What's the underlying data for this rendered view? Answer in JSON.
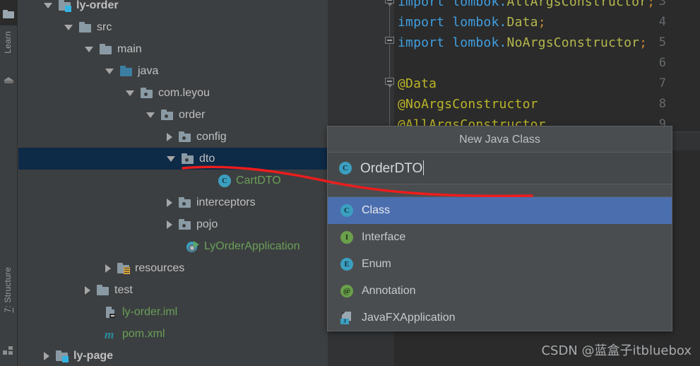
{
  "toolstrip": {
    "project_icon": "folder-icon",
    "learn_tab": "Learn",
    "learn_icon": "graduation-cap-icon",
    "structure_tab_number": "7",
    "structure_tab": ": Structure",
    "structure_icon": "structure-icon"
  },
  "tree": {
    "items": [
      {
        "label": "ly-order",
        "icon": "module-folder-icon",
        "arrow": "down",
        "indent": 36,
        "depth": 0,
        "style": "bold",
        "selected": false
      },
      {
        "label": "src",
        "icon": "folder-icon",
        "arrow": "down",
        "indent": 65,
        "depth": 1,
        "style": "normal",
        "selected": false
      },
      {
        "label": "main",
        "icon": "folder-icon",
        "arrow": "down",
        "indent": 94,
        "depth": 2,
        "style": "normal",
        "selected": false
      },
      {
        "label": "java",
        "icon": "source-folder-icon",
        "arrow": "down",
        "indent": 123,
        "depth": 3,
        "style": "normal",
        "selected": false
      },
      {
        "label": "com.leyou",
        "icon": "package-icon",
        "arrow": "down",
        "indent": 152,
        "depth": 4,
        "style": "normal",
        "selected": false
      },
      {
        "label": "order",
        "icon": "package-icon",
        "arrow": "down",
        "indent": 181,
        "depth": 5,
        "style": "normal",
        "selected": false
      },
      {
        "label": "config",
        "icon": "package-icon",
        "arrow": "right",
        "indent": 210,
        "depth": 6,
        "style": "normal",
        "selected": false
      },
      {
        "label": "dto",
        "icon": "package-icon",
        "arrow": "down",
        "indent": 210,
        "depth": 6,
        "style": "normal",
        "selected": true
      },
      {
        "label": "CartDTO",
        "icon": "java-class-icon",
        "arrow": "blank",
        "indent": 262,
        "depth": 7,
        "style": "green",
        "selected": false
      },
      {
        "label": "interceptors",
        "icon": "package-icon",
        "arrow": "right",
        "indent": 210,
        "depth": 6,
        "style": "normal",
        "selected": false
      },
      {
        "label": "pojo",
        "icon": "package-icon",
        "arrow": "right",
        "indent": 210,
        "depth": 6,
        "style": "normal",
        "selected": false
      },
      {
        "label": "LyOrderApplication",
        "icon": "spring-boot-run-icon",
        "arrow": "blank",
        "indent": 217,
        "depth": 6,
        "style": "green",
        "selected": false
      },
      {
        "label": "resources",
        "icon": "resources-folder-icon",
        "arrow": "right",
        "indent": 123,
        "depth": 3,
        "style": "normal",
        "selected": false
      },
      {
        "label": "test",
        "icon": "folder-icon",
        "arrow": "right",
        "indent": 94,
        "depth": 2,
        "style": "normal",
        "selected": false
      },
      {
        "label": "ly-order.iml",
        "icon": "iml-file-icon",
        "arrow": "blank",
        "indent": 101,
        "depth": 2,
        "style": "green",
        "selected": false
      },
      {
        "label": "pom.xml",
        "icon": "maven-file-icon",
        "arrow": "blank",
        "indent": 101,
        "depth": 2,
        "style": "green",
        "selected": false
      },
      {
        "label": "ly-page",
        "icon": "module-folder-icon",
        "arrow": "right",
        "indent": 36,
        "depth": 0,
        "style": "bold",
        "selected": false
      }
    ]
  },
  "editor": {
    "line_numbers": [
      "3",
      "4",
      "5",
      "6",
      "7",
      "8",
      "9"
    ],
    "lines": [
      {
        "n": "3",
        "tokens": [
          {
            "t": "import",
            "c": "k-kw"
          },
          {
            "t": " lombok.",
            "c": "k-pkg"
          },
          {
            "t": "AllArgsConstructor",
            "c": "k-cls"
          },
          {
            "t": ";",
            "c": "k-sc"
          }
        ]
      },
      {
        "n": "4",
        "tokens": [
          {
            "t": "import",
            "c": "k-kw"
          },
          {
            "t": " lombok.",
            "c": "k-pkg"
          },
          {
            "t": "Data",
            "c": "k-cls"
          },
          {
            "t": ";",
            "c": "k-sc"
          }
        ]
      },
      {
        "n": "5",
        "tokens": [
          {
            "t": "import",
            "c": "k-kw"
          },
          {
            "t": " lombok.",
            "c": "k-pkg"
          },
          {
            "t": "NoArgsConstructor",
            "c": "k-cls"
          },
          {
            "t": ";",
            "c": "k-sc"
          }
        ]
      },
      {
        "n": "6",
        "tokens": []
      },
      {
        "n": "7",
        "tokens": [
          {
            "t": "@Data",
            "c": "k-ann"
          }
        ]
      },
      {
        "n": "8",
        "tokens": [
          {
            "t": "@NoArgsConstructor",
            "c": "k-ann"
          }
        ]
      },
      {
        "n": "9",
        "tokens": [
          {
            "t": "@AllArgsConstructor",
            "c": "k-ann"
          }
        ]
      }
    ]
  },
  "dialog": {
    "title": "New Java Class",
    "input_icon": "java-class-icon",
    "input_value": "OrderDTO",
    "items": [
      {
        "label": "Class",
        "icon": "java-class-icon",
        "glyph": "C",
        "icon_class": "circ-c",
        "selected": true
      },
      {
        "label": "Interface",
        "icon": "java-interface-icon",
        "glyph": "I",
        "icon_class": "circ-i",
        "selected": false
      },
      {
        "label": "Enum",
        "icon": "java-enum-icon",
        "glyph": "E",
        "icon_class": "circ-e",
        "selected": false
      },
      {
        "label": "Annotation",
        "icon": "java-annotation-icon",
        "glyph": "@",
        "icon_class": "circ-a",
        "selected": false
      },
      {
        "label": "JavaFXApplication",
        "icon": "javafx-app-icon",
        "glyph": "J",
        "icon_class": "fx",
        "selected": false
      }
    ]
  },
  "annotation": {
    "color": "#ef1c1c",
    "shape": "hand-drawn-curve-from-dto-to-dialog-input"
  },
  "watermark": {
    "text": "CSDN @蓝盒子itbluebox"
  },
  "colors": {
    "panel_bg": "#3c3f41",
    "editor_bg": "#2b2b2b",
    "gutter_bg": "#313335",
    "selection_tree": "#0d2a47",
    "selection_list": "#4b6eaf",
    "dialog_bg": "#4a4d4f",
    "green_text": "#6a9f58",
    "annotation_red": "#ef1c1c"
  }
}
